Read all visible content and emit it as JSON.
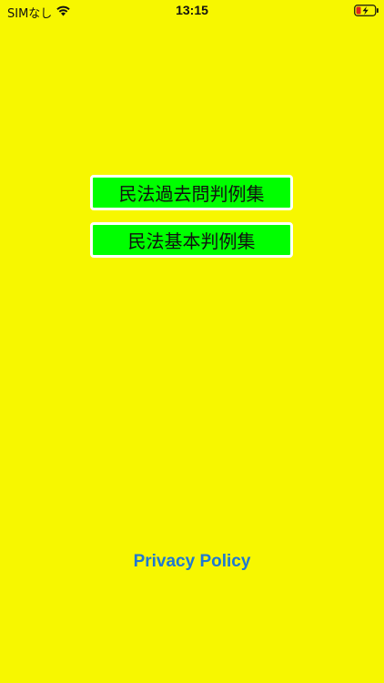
{
  "status_bar": {
    "carrier": "SIMなし",
    "time": "13:15",
    "wifi_icon": "wifi-icon",
    "battery_icon": "battery-charging-icon"
  },
  "menu": {
    "buttons": [
      {
        "label": "民法過去問判例集"
      },
      {
        "label": "民法基本判例集"
      }
    ]
  },
  "footer": {
    "privacy_label": "Privacy Policy"
  },
  "colors": {
    "background": "#f7f700",
    "button_fill": "#00ff00",
    "button_border": "#ffffff",
    "link": "#1f78d1"
  }
}
